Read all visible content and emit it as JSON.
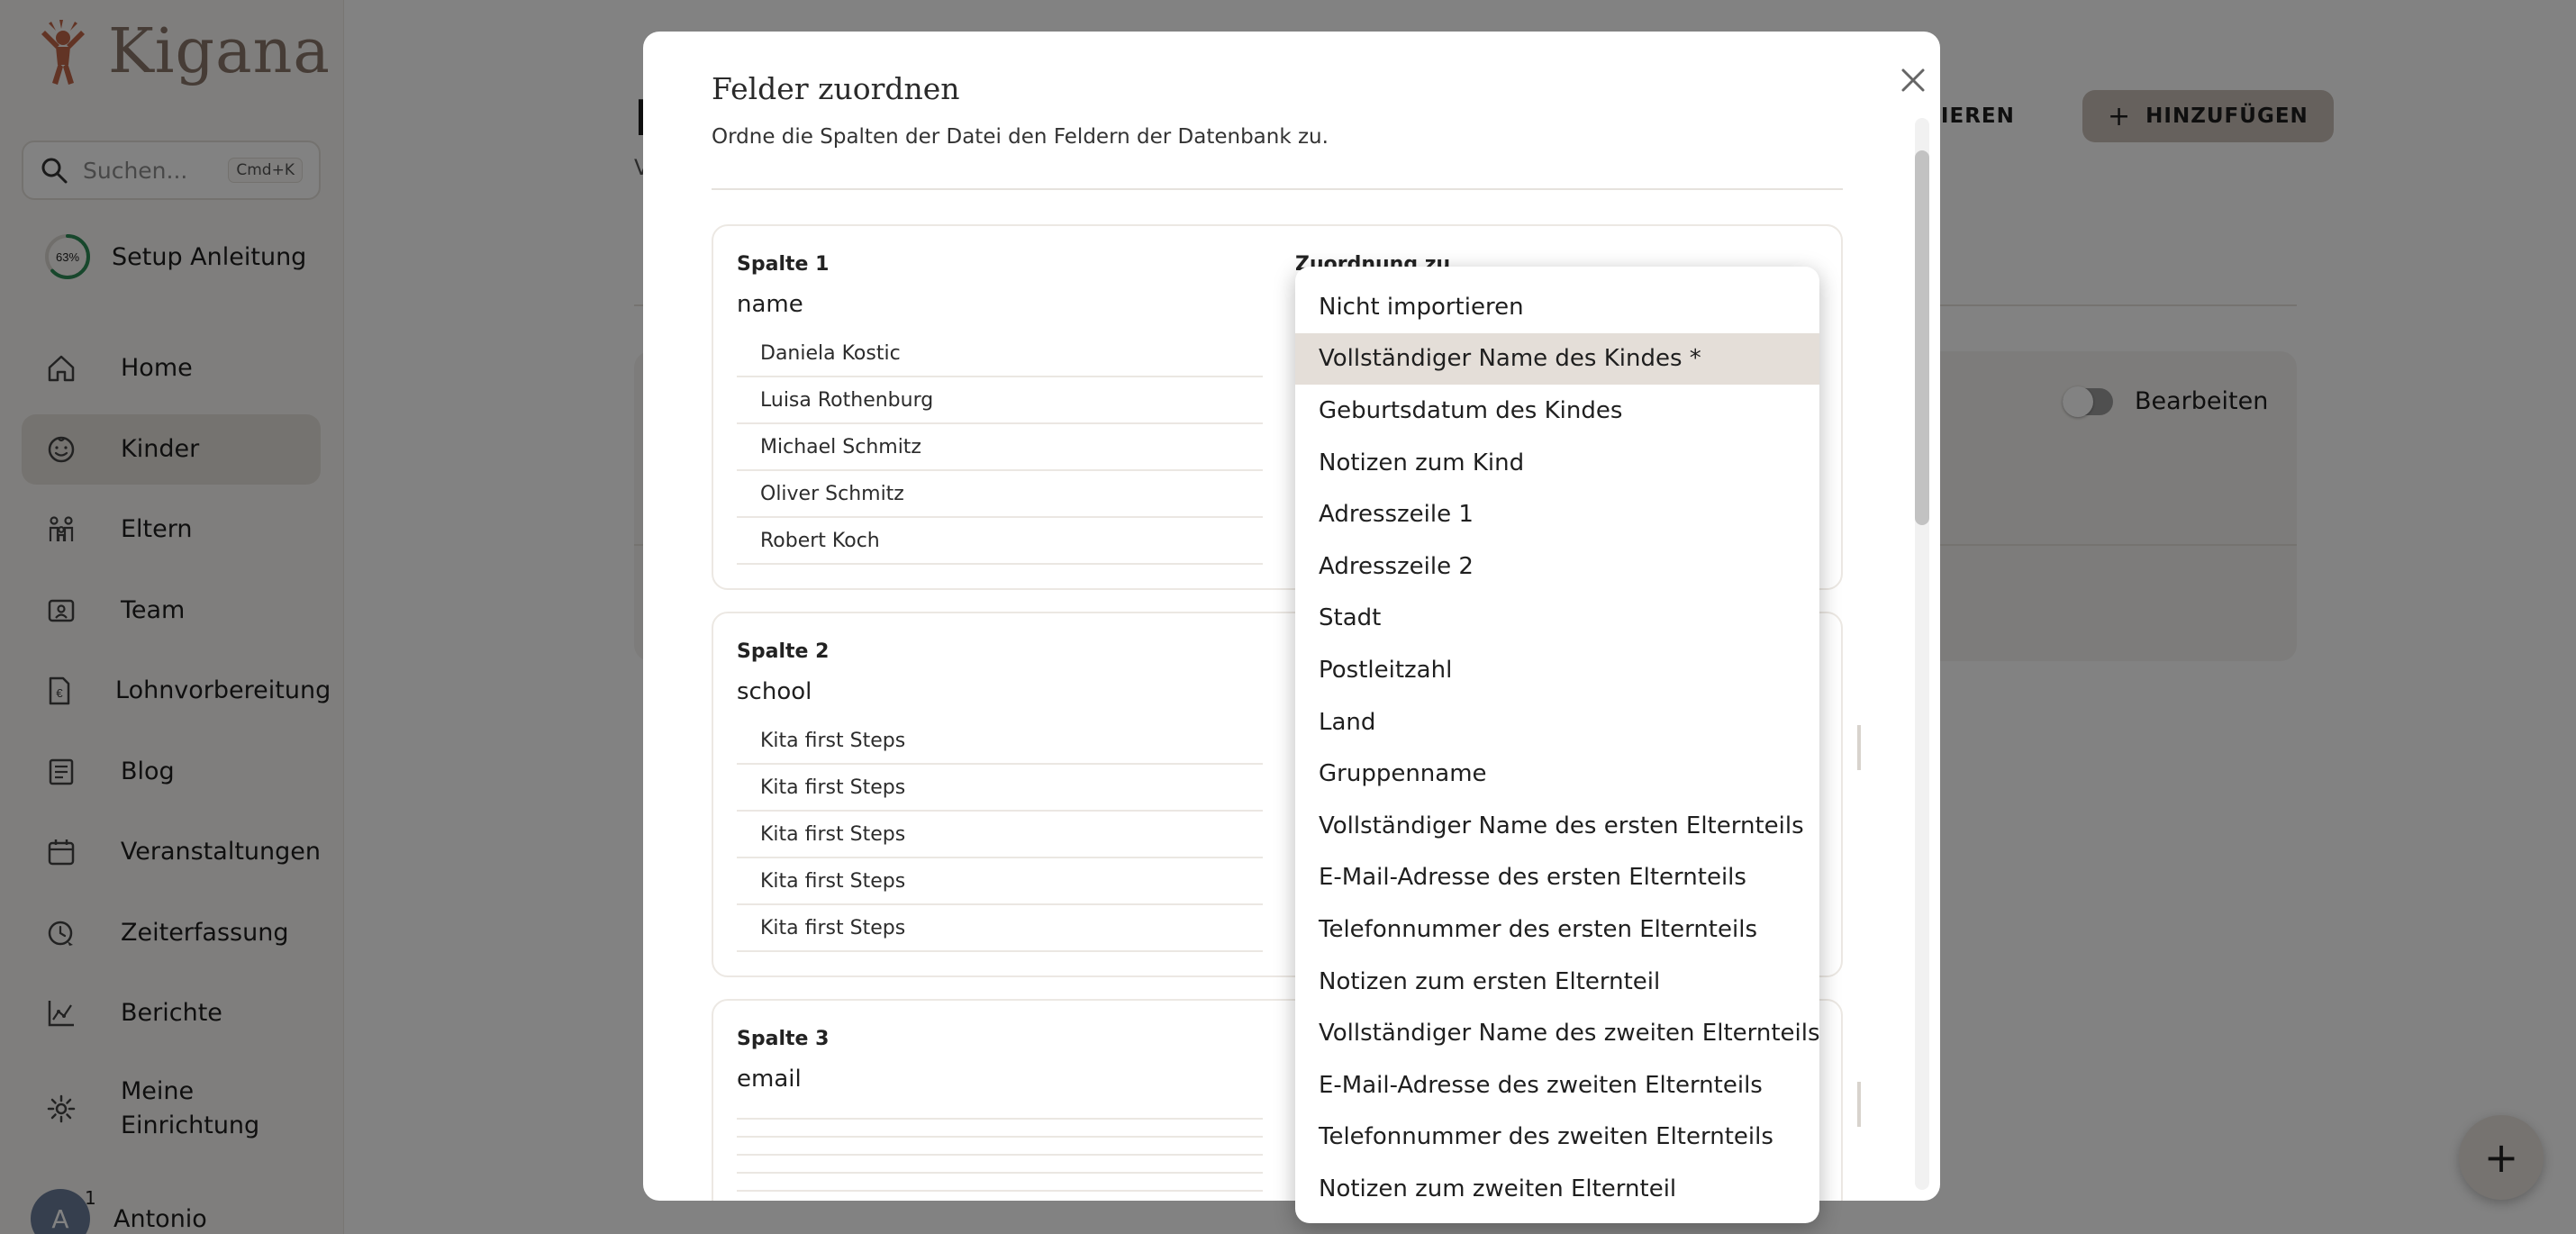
{
  "app": {
    "name": "Kigana"
  },
  "sidebar": {
    "search": {
      "placeholder": "Suchen...",
      "shortcut": "Cmd+K"
    },
    "setup": {
      "progress_label": "63%",
      "progress_value": 63,
      "label": "Setup Anleitung"
    },
    "items": [
      {
        "label": "Home",
        "icon": "home-icon",
        "active": false
      },
      {
        "label": "Kinder",
        "icon": "child-face-icon",
        "active": true
      },
      {
        "label": "Eltern",
        "icon": "family-icon",
        "active": false
      },
      {
        "label": "Team",
        "icon": "id-badge-icon",
        "active": false
      },
      {
        "label": "Lohnvorbereitung",
        "icon": "payroll-icon",
        "active": false
      },
      {
        "label": "Blog",
        "icon": "blog-icon",
        "active": false
      },
      {
        "label": "Veranstaltungen",
        "icon": "calendar-icon",
        "active": false
      },
      {
        "label": "Zeiterfassung",
        "icon": "clock-icon",
        "active": false
      },
      {
        "label": "Berichte",
        "icon": "chart-icon",
        "active": false
      },
      {
        "label": "Meine Einrichtung",
        "icon": "gear-icon",
        "active": false
      }
    ],
    "user": {
      "initial": "A",
      "name": "Antonio",
      "badge": "1"
    }
  },
  "page": {
    "title_fragment": "K",
    "subtitle_fragment": "V",
    "import_label": "ORTIEREN",
    "add_label": "HINZUFÜGEN",
    "edit_label": "Bearbeiten"
  },
  "modal": {
    "title": "Felder zuordnen",
    "description": "Ordne die Spalten der Datei den Feldern der Datenbank zu.",
    "mapping_label": "Zuordnung zu",
    "columns": [
      {
        "title": "Spalte 1",
        "field": "name",
        "samples": [
          "Daniela Kostic",
          "Luisa Rothenburg",
          "Michael Schmitz",
          "Oliver Schmitz",
          "Robert Koch"
        ]
      },
      {
        "title": "Spalte 2",
        "field": "school",
        "samples": [
          "Kita first Steps",
          "Kita first Steps",
          "Kita first Steps",
          "Kita first Steps",
          "Kita first Steps"
        ]
      },
      {
        "title": "Spalte 3",
        "field": "email",
        "samples": [
          "",
          "",
          "",
          "",
          ""
        ]
      }
    ]
  },
  "dropdown": {
    "selected_index": 1,
    "options": [
      "Nicht importieren",
      "Vollständiger Name des Kindes *",
      "Geburtsdatum des Kindes",
      "Notizen zum Kind",
      "Adresszeile 1",
      "Adresszeile 2",
      "Stadt",
      "Postleitzahl",
      "Land",
      "Gruppenname",
      "Vollständiger Name des ersten Elternteils",
      "E-Mail-Adresse des ersten Elternteils",
      "Telefonnummer des ersten Elternteils",
      "Notizen zum ersten Elternteil",
      "Vollständiger Name des zweiten Elternteils",
      "E-Mail-Adresse des zweiten Elternteils",
      "Telefonnummer des zweiten Elternteils",
      "Notizen zum zweiten Elternteil"
    ]
  },
  "colors": {
    "accent_logo": "#c0674a",
    "active_nav": "#e6e1dc",
    "selected_option": "#e4ded8",
    "progress_ring": "#2e8b57"
  }
}
